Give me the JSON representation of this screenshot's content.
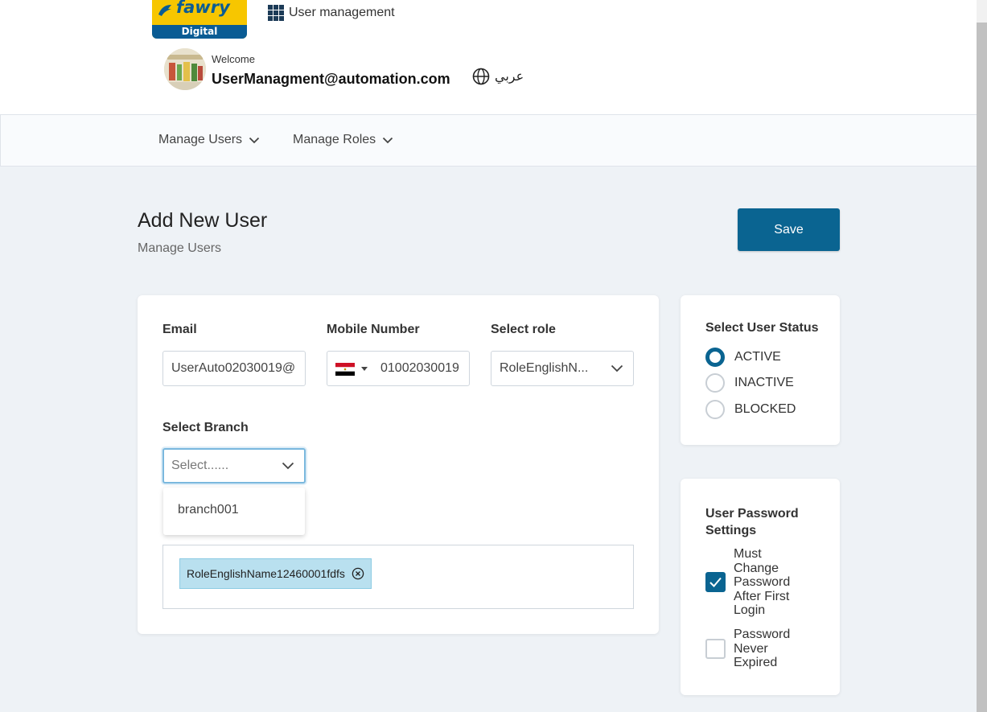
{
  "header": {
    "logo_text": "fawry",
    "logo_sub": "Digital",
    "app_title": "User management",
    "welcome": "Welcome",
    "user_email": "UserManagment@automation.com",
    "language": "عربي"
  },
  "nav": {
    "items": [
      {
        "label": "Manage Users"
      },
      {
        "label": "Manage Roles"
      }
    ]
  },
  "page": {
    "title": "Add New User",
    "breadcrumb": "Manage Users",
    "save_label": "Save"
  },
  "form": {
    "email": {
      "label": "Email",
      "value": "UserAuto02030019@"
    },
    "mobile": {
      "label": "Mobile Number",
      "value": "01002030019"
    },
    "role": {
      "label": "Select role",
      "value": "RoleEnglishN..."
    },
    "branch": {
      "label": "Select Branch",
      "placeholder": "Select......",
      "options": [
        "branch001"
      ]
    },
    "selected_roles": [
      "RoleEnglishName12460001fdfs"
    ]
  },
  "status": {
    "title": "Select User Status",
    "options": [
      {
        "label": "ACTIVE",
        "selected": true
      },
      {
        "label": "INACTIVE",
        "selected": false
      },
      {
        "label": "BLOCKED",
        "selected": false
      }
    ]
  },
  "password_settings": {
    "title": "User Password Settings",
    "options": [
      {
        "label": "Must Change Password After First Login",
        "checked": true
      },
      {
        "label": "Password Never Expired",
        "checked": false
      }
    ]
  },
  "colors": {
    "primary": "#0a6491",
    "page_bg": "#eef2f6",
    "chip_bg": "#b9e0ef"
  }
}
